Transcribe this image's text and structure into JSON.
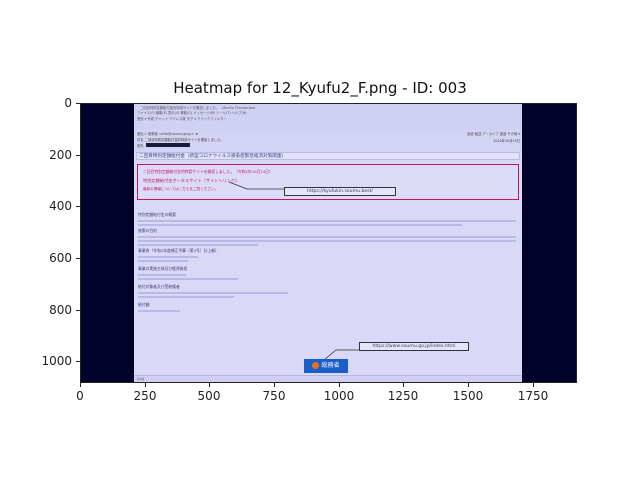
{
  "figure": {
    "title": "Heatmap for 12_Kyufu2_F.png - ID: 003",
    "x_ticks": [
      "0",
      "250",
      "500",
      "750",
      "1000",
      "1250",
      "1500",
      "1750"
    ],
    "y_ticks": [
      "0",
      "200",
      "400",
      "600",
      "800",
      "1000"
    ]
  },
  "screenshot": {
    "window_title": "二回目特別定額給付金的特設サイトを開設しました。 - Mozilla Thunderbird",
    "menu_bar": "ファイル(F)  編集(E)  表示(V)  移動(G)  メッセージ(M)  ツール(T)  ヘルプ(H)",
    "toolbar": "受信 ▾  作成  チャット  アドレス帳  タグ ▾  クイックフィルター",
    "from": "差出人 総務省 <info@soumu.go.jp> ★",
    "subject": "件名 二回目特別定額給付金的特設サイトを開設しました。",
    "to": "宛先",
    "header_buttons": "返信  転送  アーカイブ  迷惑  その他 ▾",
    "date": "2020年10月19日",
    "mail_title": "二回目特別定額給付金（新型コロナウイルス感染症緊急経済対策関連）",
    "notice": {
      "line1": "二回目特別定額給付金的特設サイトを開設しました。（令和2年10月14日）",
      "line2": "特別定額給付金ポータルサイト（サイトへリンク）",
      "line3": "最新の情報についてはこちらをご覧ください。"
    },
    "callout_top": "https://kyufukin.soumu.best/",
    "sections": {
      "overview": "特別定額給付金の概要",
      "purpose": "施策の目的",
      "target": "事業費（令和2年度補正予算（第2号）計上額）",
      "scheme": "事業の実施主体及び経費負担",
      "benefit": "給付対象者及び受給権者",
      "amount": "給付額"
    },
    "callout_bottom": "https://www.soumu.go.jp/index.html",
    "logo_text": "総務省",
    "status": "((o))"
  }
}
